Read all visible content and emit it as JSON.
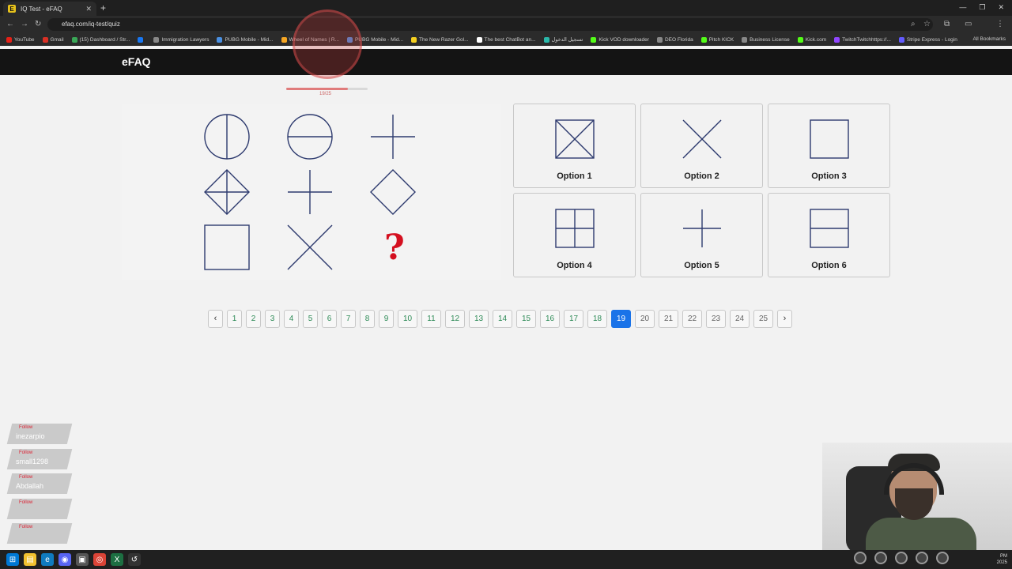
{
  "browser": {
    "tab_title": "IQ Test - eFAQ",
    "tab_favicon": "E",
    "url": "efaq.com/iq-test/quiz",
    "bookmarks": [
      {
        "label": "YouTube",
        "color": "#e62117"
      },
      {
        "label": "Gmail",
        "color": "#d93025"
      },
      {
        "label": "(15) Dashboard / Str...",
        "color": "#3aa757"
      },
      {
        "label": "",
        "color": "#1877f2"
      },
      {
        "label": "Immigration Lawyers",
        "color": "#888888"
      },
      {
        "label": "PUBG Mobile - Mid...",
        "color": "#4a90e2"
      },
      {
        "label": "Wheel of Names | R...",
        "color": "#f5a623"
      },
      {
        "label": "PUBG Mobile - Mid...",
        "color": "#4a90e2"
      },
      {
        "label": "The New Razer Gol...",
        "color": "#f5d020"
      },
      {
        "label": "The best ChatBot an...",
        "color": "#ffffff"
      },
      {
        "label": "تسجيل الدخول",
        "color": "#2ab7a9"
      },
      {
        "label": "Kick VOD downloader",
        "color": "#53fc18"
      },
      {
        "label": "DEO Florida",
        "color": "#888888"
      },
      {
        "label": "Pitch KICK",
        "color": "#53fc18"
      },
      {
        "label": "Business License",
        "color": "#888888"
      },
      {
        "label": "Kick.com",
        "color": "#53fc18"
      },
      {
        "label": "TwitchTwitchhttps://...",
        "color": "#9146ff"
      },
      {
        "label": "Stripe Express - Login",
        "color": "#635bff"
      }
    ],
    "all_bookmarks": "All Bookmarks"
  },
  "site": {
    "brand": "eFAQ",
    "progress_fraction": 0.76,
    "progress_text": "19/25"
  },
  "puzzle": {
    "cells": [
      {
        "shape": "circle-vertical-line"
      },
      {
        "shape": "circle-horizontal-line"
      },
      {
        "shape": "plus"
      },
      {
        "shape": "diamond-cross"
      },
      {
        "shape": "plus"
      },
      {
        "shape": "diamond"
      },
      {
        "shape": "square"
      },
      {
        "shape": "x"
      },
      {
        "shape": "question"
      }
    ],
    "question_mark": "?"
  },
  "options": [
    {
      "label": "Option 1",
      "shape": "square-x"
    },
    {
      "label": "Option 2",
      "shape": "x"
    },
    {
      "label": "Option 3",
      "shape": "square"
    },
    {
      "label": "Option 4",
      "shape": "square-plus"
    },
    {
      "label": "Option 5",
      "shape": "plus"
    },
    {
      "label": "Option 6",
      "shape": "square-horizontal-line"
    }
  ],
  "pagination": {
    "prev": "‹",
    "next": "›",
    "pages": [
      "1",
      "2",
      "3",
      "4",
      "5",
      "6",
      "7",
      "8",
      "9",
      "10",
      "11",
      "12",
      "13",
      "14",
      "15",
      "16",
      "17",
      "18",
      "19",
      "20",
      "21",
      "22",
      "23",
      "24",
      "25"
    ],
    "current": "19"
  },
  "stream": {
    "followers": [
      {
        "label": "Follow",
        "name": "inezarpio"
      },
      {
        "label": "Follow",
        "name": "small1298"
      },
      {
        "label": "Follow",
        "name": "Abdallah"
      },
      {
        "label": "Follow",
        "name": ""
      },
      {
        "label": "Follow",
        "name": ""
      }
    ]
  },
  "taskbar": {
    "clock_time": "PM",
    "clock_date": "2025"
  },
  "colors": {
    "shape_stroke": "#2d3a6e",
    "question_mark": "#d40f1f",
    "active_page": "#1a73e8",
    "page_text": "#2e8b57"
  }
}
